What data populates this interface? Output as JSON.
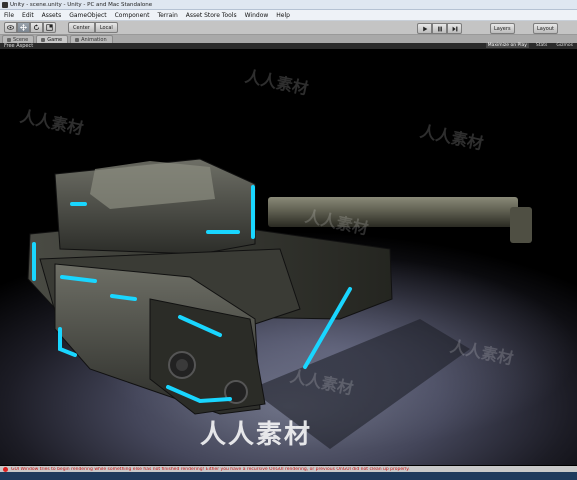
{
  "window": {
    "title": "Unity - scene.unity - Unity - PC and Mac Standalone"
  },
  "menu": [
    "File",
    "Edit",
    "Assets",
    "GameObject",
    "Component",
    "Terrain",
    "Asset Store Tools",
    "Window",
    "Help"
  ],
  "toolbar": {
    "pivot_label": "Center",
    "space_label": "Local",
    "layers_label": "Layers",
    "layout_label": "Layout"
  },
  "tabs": [
    {
      "label": "Scene",
      "icon": "scene-icon"
    },
    {
      "label": "Game",
      "icon": "game-icon"
    },
    {
      "label": "Animation",
      "icon": "animation-icon"
    }
  ],
  "game_view": {
    "aspect": "Free Aspect",
    "maximize": "Maximize on Play",
    "stats": "Stats",
    "gizmos": "Gizmos"
  },
  "watermarks": [
    "人人素材",
    "人人素材",
    "人人素材",
    "人人素材",
    "人人素材",
    "人人素材"
  ],
  "watermark_main": "人人素材",
  "status": {
    "message": "GUI Window tries to begin rendering while something else has not finished rendering! Either you have a recursive OnGUI rendering, or previous OnGUI did not clean up properly."
  },
  "colors": {
    "accent_glow": "#19d6ff",
    "error": "#cc1111"
  }
}
